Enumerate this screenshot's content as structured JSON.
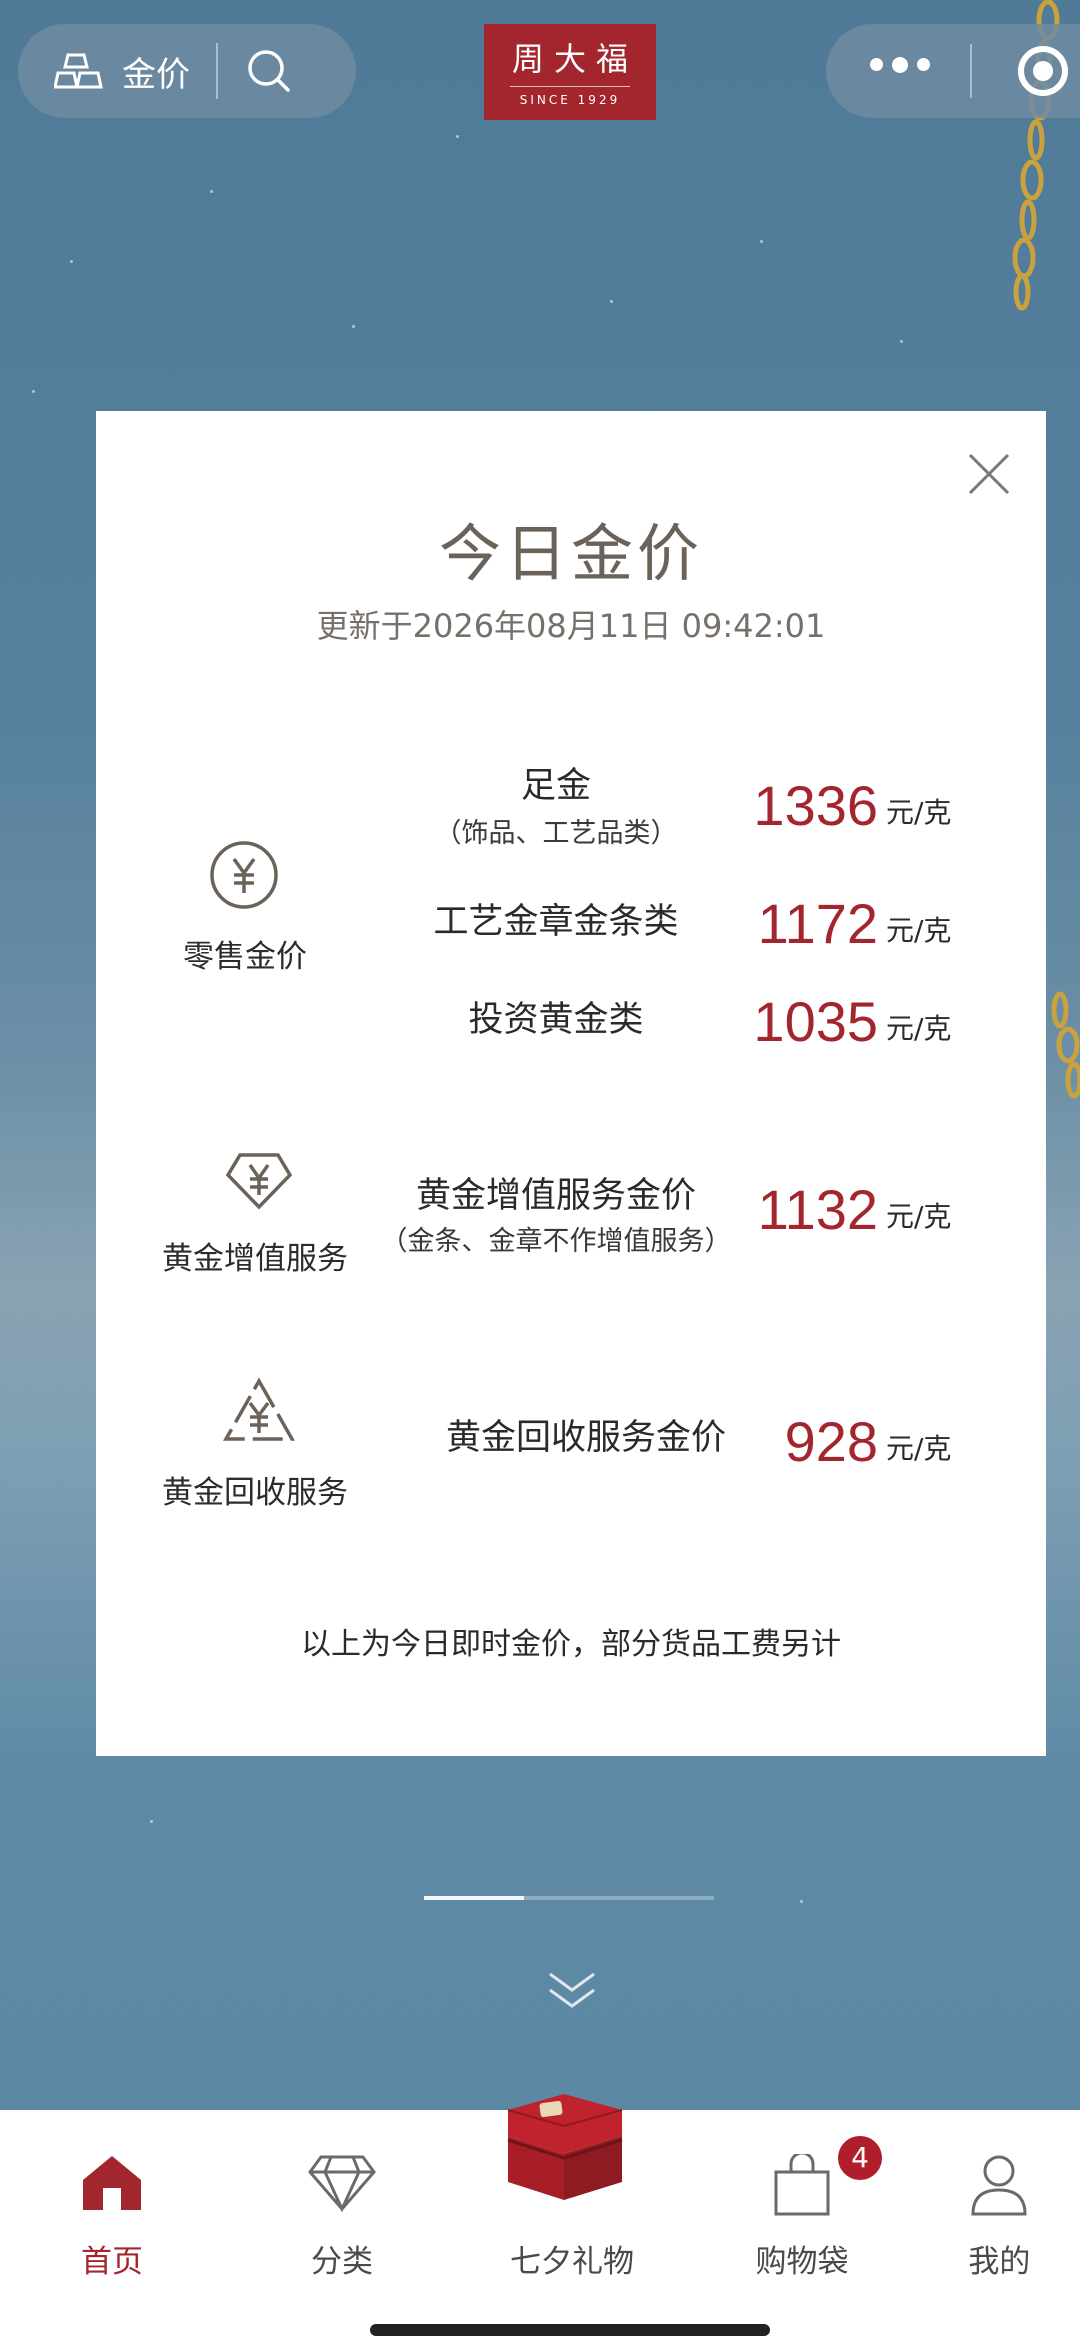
{
  "topbar": {
    "gold_price_label": "金价",
    "logo_brand": "周大福",
    "logo_since": "SINCE 1929"
  },
  "modal": {
    "title": "今日金价",
    "updated": "更新于2026年08月11日 09:42:01",
    "categories": [
      {
        "label": "零售金价",
        "icon": "yuan-circle-icon"
      },
      {
        "label": "黄金增值服务",
        "icon": "yuan-diamond-icon"
      },
      {
        "label": "黄金回收服务",
        "icon": "yuan-recycle-icon"
      }
    ],
    "items": [
      {
        "name": "足金",
        "sub": "（饰品、工艺品类）",
        "price": "1336",
        "unit": "元/克"
      },
      {
        "name": "工艺金章金条类",
        "sub": "",
        "price": "1172",
        "unit": "元/克"
      },
      {
        "name": "投资黄金类",
        "sub": "",
        "price": "1035",
        "unit": "元/克"
      },
      {
        "name": "黄金增值服务金价",
        "sub": "（金条、金章不作增值服务）",
        "price": "1132",
        "unit": "元/克"
      },
      {
        "name": "黄金回收服务金价",
        "sub": "",
        "price": "928",
        "unit": "元/克"
      }
    ],
    "footnote": "以上为今日即时金价，部分货品工费另计"
  },
  "tabbar": {
    "tabs": [
      {
        "label": "首页",
        "icon": "home-icon",
        "active": true
      },
      {
        "label": "分类",
        "icon": "diamond-icon"
      },
      {
        "label": "七夕礼物",
        "icon": "gift-box-icon"
      },
      {
        "label": "购物袋",
        "icon": "shopping-bag-icon"
      },
      {
        "label": "我的",
        "icon": "user-icon"
      }
    ],
    "cart_badge": "4"
  },
  "colors": {
    "accent": "#a3262e",
    "background": "#5a87a3"
  }
}
